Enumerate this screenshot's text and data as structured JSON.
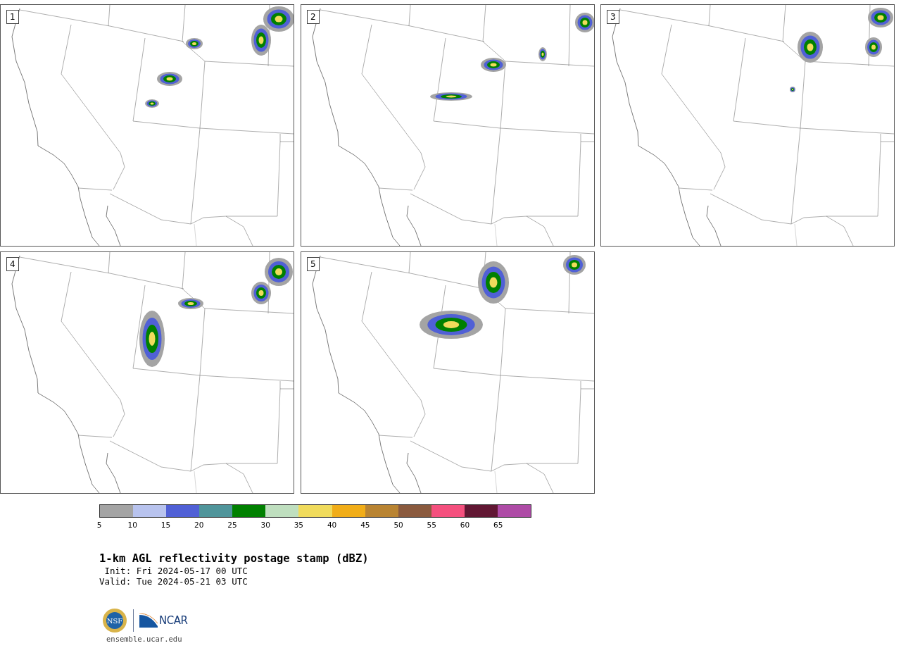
{
  "panels": [
    {
      "label": "1"
    },
    {
      "label": "2"
    },
    {
      "label": "3"
    },
    {
      "label": "4"
    },
    {
      "label": "5"
    }
  ],
  "colorbar": {
    "bins": [
      {
        "color": "#a4a4a4",
        "tick": "5"
      },
      {
        "color": "#b8c3ee",
        "tick": "10"
      },
      {
        "color": "#5060d6",
        "tick": "15"
      },
      {
        "color": "#50959b",
        "tick": "20"
      },
      {
        "color": "#008000",
        "tick": "25"
      },
      {
        "color": "#bfdfbf",
        "tick": "30"
      },
      {
        "color": "#f0db5c",
        "tick": "35"
      },
      {
        "color": "#f1ad18",
        "tick": "40"
      },
      {
        "color": "#b98432",
        "tick": "45"
      },
      {
        "color": "#8a5a3e",
        "tick": "50"
      },
      {
        "color": "#f4507e",
        "tick": "55"
      },
      {
        "color": "#611733",
        "tick": "60"
      },
      {
        "color": "#ae4ba6",
        "tick": "65"
      }
    ]
  },
  "title": "1-km AGL reflectivity postage stamp (dBZ)",
  "init": " Init: Fri 2024-05-17 00 UTC",
  "valid": "Valid: Tue 2024-05-21 03 UTC",
  "logo": {
    "nsf": "NSF",
    "ncar": "NCAR"
  },
  "url": "ensemble.ucar.edu"
}
